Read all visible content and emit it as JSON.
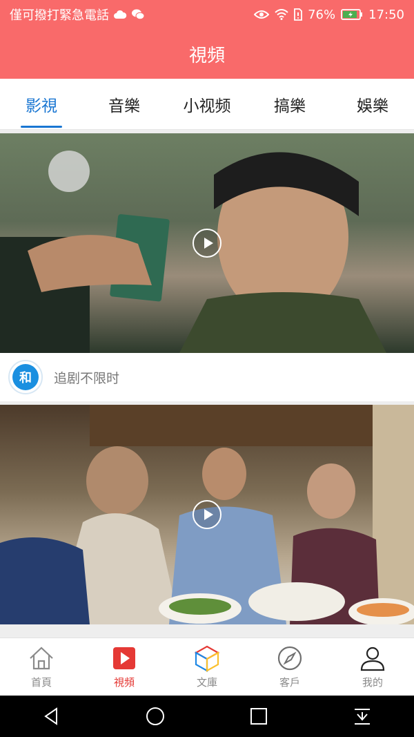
{
  "status_bar": {
    "carrier_text": "僅可撥打緊急電話",
    "battery_percent": "76%",
    "time": "17:50"
  },
  "header": {
    "title": "視頻"
  },
  "tabs": [
    {
      "label": "影視",
      "active": true
    },
    {
      "label": "音樂",
      "active": false
    },
    {
      "label": "小视频",
      "active": false
    },
    {
      "label": "搞樂",
      "active": false
    },
    {
      "label": "娛樂",
      "active": false
    }
  ],
  "feed": {
    "cards": [
      {
        "source_logo_text": "和",
        "title": "追剧不限时"
      },
      {
        "source_logo_text": "",
        "title": ""
      }
    ]
  },
  "bottom_nav": [
    {
      "label": "首頁",
      "icon": "home-icon",
      "active": false
    },
    {
      "label": "視頻",
      "icon": "video-play-icon",
      "active": true
    },
    {
      "label": "文庫",
      "icon": "cube-icon",
      "active": false
    },
    {
      "label": "客戶",
      "icon": "compass-icon",
      "active": false
    },
    {
      "label": "我的",
      "icon": "user-icon",
      "active": false
    }
  ],
  "colors": {
    "header_bg": "#f96a6a",
    "tab_active": "#1976d2",
    "nav_active": "#e53935"
  }
}
